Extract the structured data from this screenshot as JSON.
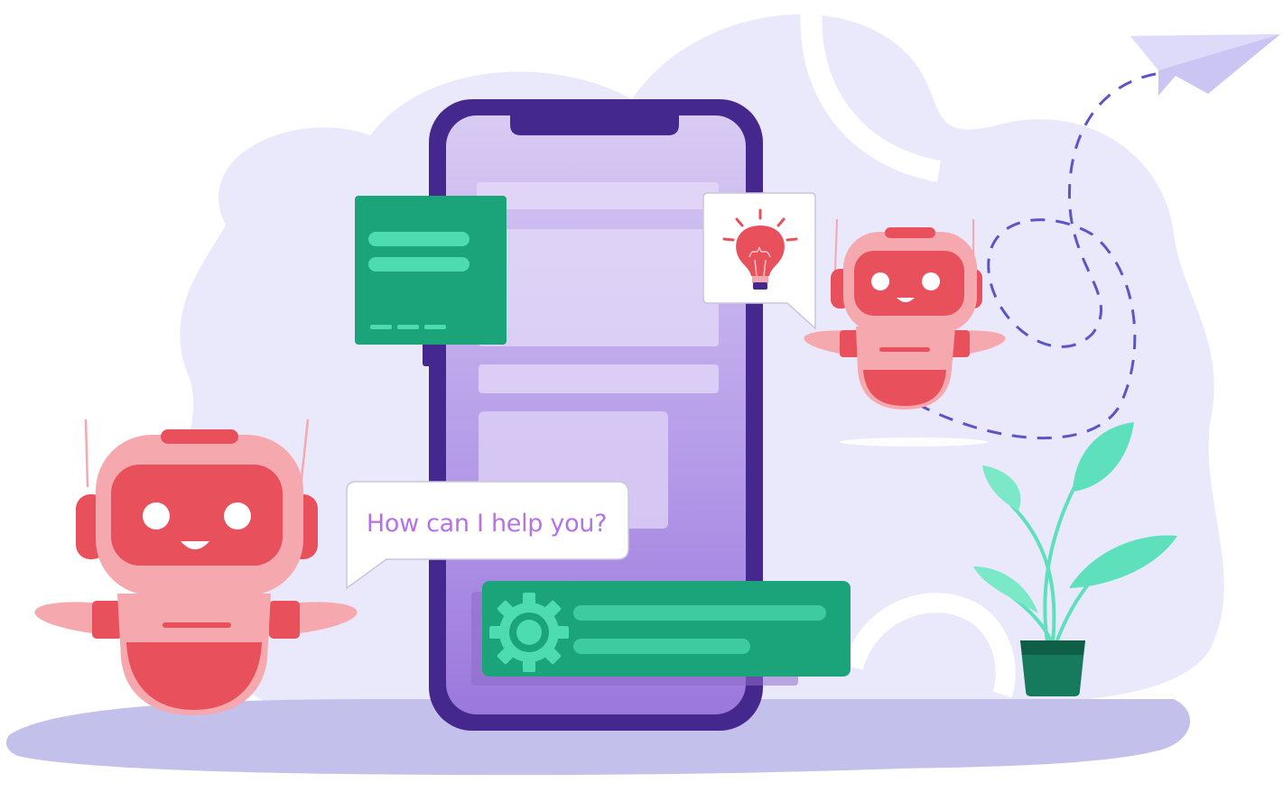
{
  "speech_bubble": {
    "text": "How can I help you?"
  },
  "colors": {
    "background_blob": "#EAE8FB",
    "ground_shadow": "#C4C0EC",
    "phone_frame": "#45288E",
    "phone_screen": "#A886E2",
    "card_green": "#1BA37A",
    "card_green_light": "#4DDBB0",
    "robot_red": "#E8505B",
    "robot_pink": "#F5A9AE",
    "bubble_text": "#B472E6",
    "dash_line": "#5B55C8",
    "plant_leaf": "#5FE0BD",
    "pot": "#167A5C"
  },
  "icons": [
    "paper-plane-icon",
    "lightbulb-icon",
    "gear-icon",
    "robot-icon"
  ]
}
